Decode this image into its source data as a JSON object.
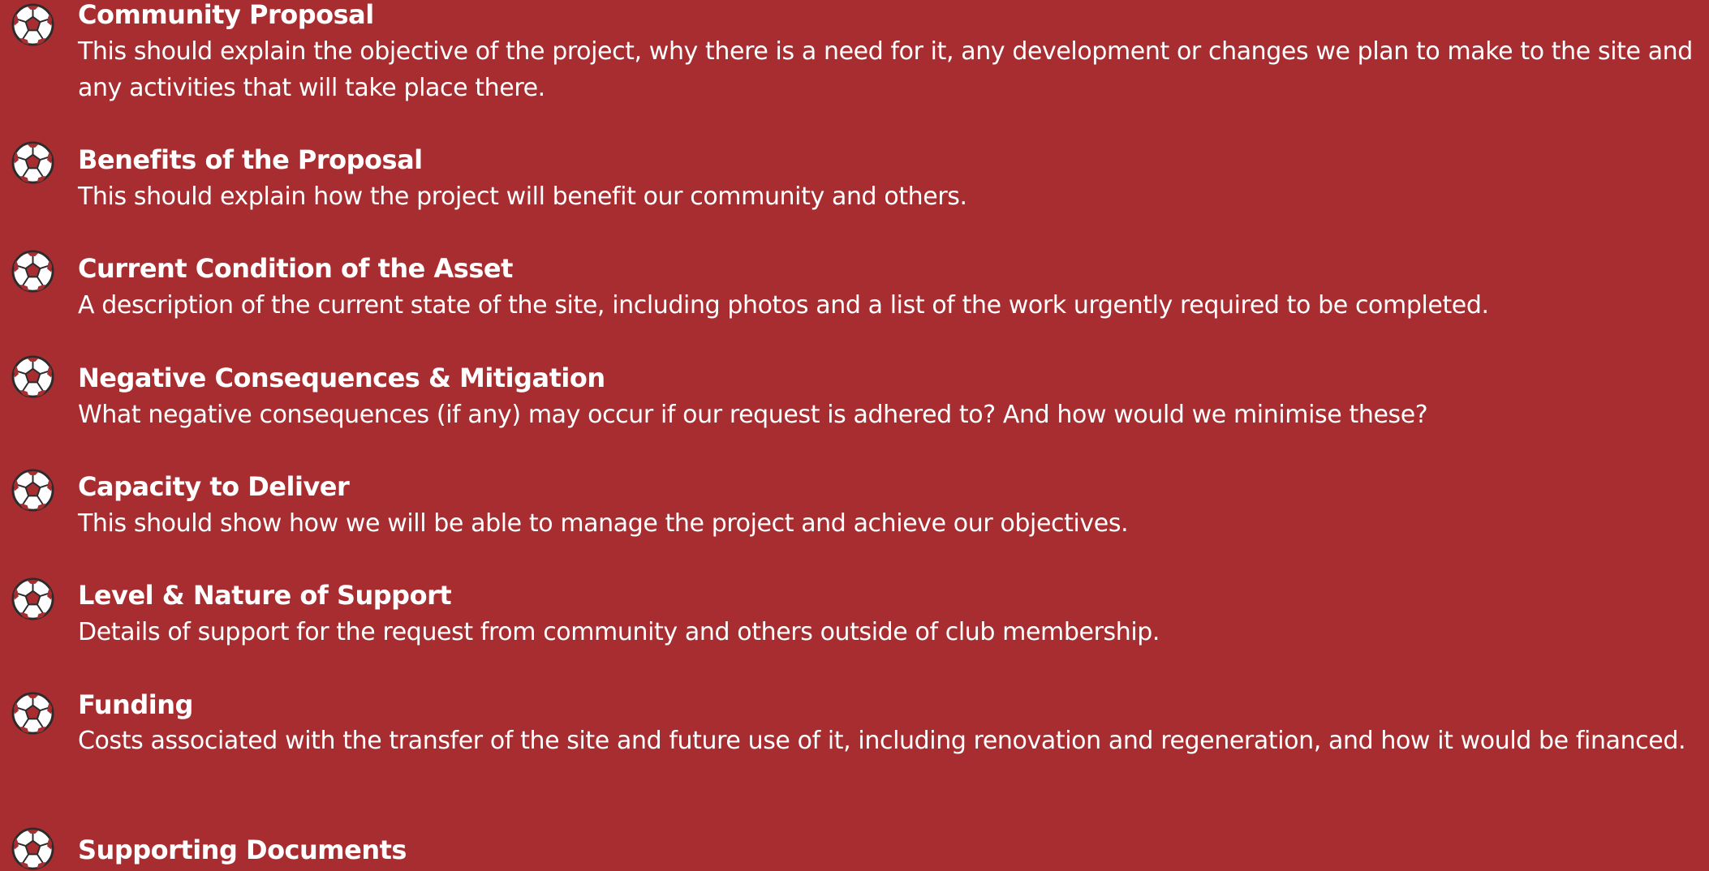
{
  "colors": {
    "background": "#a82d30",
    "text": "#ffffff",
    "icon_fill": "#ffffff",
    "icon_stroke": "#2b2b2b",
    "icon_patch": "#a82d30"
  },
  "icon_name": "football-icon",
  "items": [
    {
      "title": "Community Proposal",
      "description": "This should explain the objective of the project, why there is a need for it, any development or changes we plan to make to the site and any activities that will take place there."
    },
    {
      "title": "Benefits of the Proposal",
      "description": "This should explain how the project will benefit our community and others."
    },
    {
      "title": "Current Condition of the Asset",
      "description": "A description of the current state of the site, including photos and a list of the work urgently required to be completed."
    },
    {
      "title": "Negative Consequences & Mitigation",
      "description": "What negative consequences (if any) may occur if our request is adhered to? And how would we minimise these?"
    },
    {
      "title": "Capacity to Deliver",
      "description": "This should show how we will be able to manage the project and achieve our objectives."
    },
    {
      "title": "Level & Nature of Support",
      "description": "Details of support for the request from community and others outside of club membership."
    },
    {
      "title": "Funding",
      "description": "Costs associated with the transfer of the site and future use of it, including  renovation and regeneration, and how it would be financed."
    },
    {
      "title": "Supporting Documents",
      "description": ""
    }
  ]
}
